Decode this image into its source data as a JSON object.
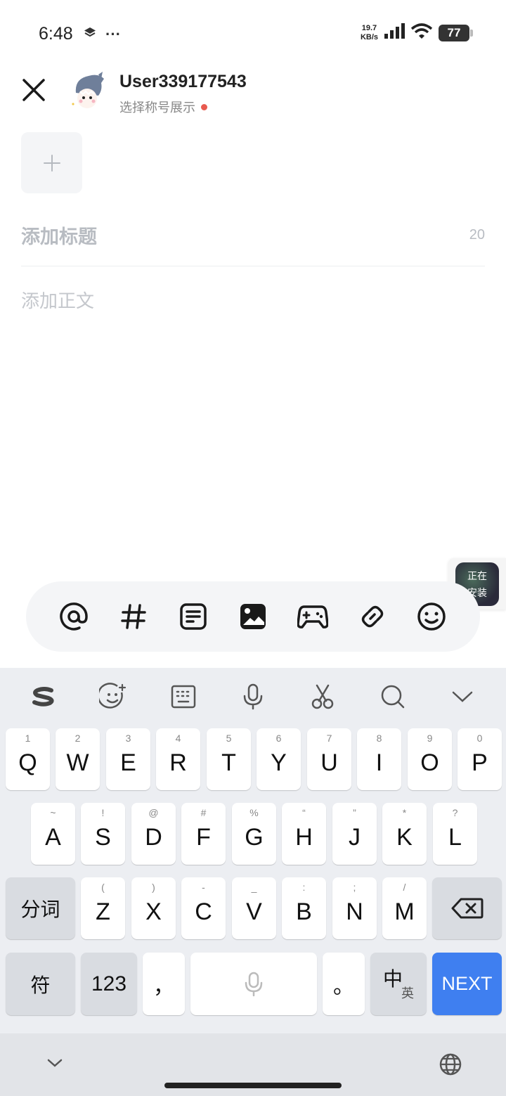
{
  "status_bar": {
    "time": "6:48",
    "more": "···",
    "net_speed_value": "19.7",
    "net_speed_unit": "KB/s",
    "battery": "77"
  },
  "header": {
    "username": "User339177543",
    "title_select": "选择称号展示"
  },
  "editor": {
    "title_placeholder": "添加标题",
    "title_remaining": "20",
    "body_placeholder": "添加正文"
  },
  "toolbar": {
    "items": [
      "mention-icon",
      "hashtag-icon",
      "note-icon",
      "image-icon",
      "gamepad-icon",
      "link-icon",
      "emoji-icon"
    ]
  },
  "install_badge": {
    "line1": "正在",
    "line2": "安装"
  },
  "keyboard": {
    "row1": [
      {
        "key": "Q",
        "hint": "1"
      },
      {
        "key": "W",
        "hint": "2"
      },
      {
        "key": "E",
        "hint": "3"
      },
      {
        "key": "R",
        "hint": "4"
      },
      {
        "key": "T",
        "hint": "5"
      },
      {
        "key": "Y",
        "hint": "6"
      },
      {
        "key": "U",
        "hint": "7"
      },
      {
        "key": "I",
        "hint": "8"
      },
      {
        "key": "O",
        "hint": "9"
      },
      {
        "key": "P",
        "hint": "0"
      }
    ],
    "row2": [
      {
        "key": "A",
        "hint": "~"
      },
      {
        "key": "S",
        "hint": "!"
      },
      {
        "key": "D",
        "hint": "@"
      },
      {
        "key": "F",
        "hint": "#"
      },
      {
        "key": "G",
        "hint": "%"
      },
      {
        "key": "H",
        "hint": "“"
      },
      {
        "key": "J",
        "hint": "”"
      },
      {
        "key": "K",
        "hint": "*"
      },
      {
        "key": "L",
        "hint": "?"
      }
    ],
    "row3": [
      {
        "key": "Z",
        "hint": "("
      },
      {
        "key": "X",
        "hint": ")"
      },
      {
        "key": "C",
        "hint": "-"
      },
      {
        "key": "V",
        "hint": "_"
      },
      {
        "key": "B",
        "hint": ":"
      },
      {
        "key": "N",
        "hint": ";"
      },
      {
        "key": "M",
        "hint": "/"
      }
    ],
    "segment_key": "分词",
    "symbol_key": "符",
    "num_key": "123",
    "comma_key": "，",
    "period_key": "。",
    "lang_main": "中",
    "lang_sub": "英",
    "next_key": "NEXT"
  }
}
